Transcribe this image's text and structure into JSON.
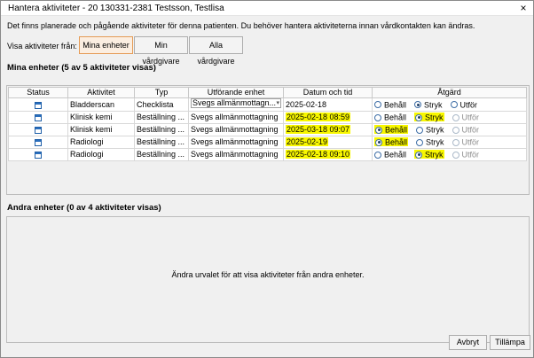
{
  "window": {
    "title": "Hantera aktiviteter - 20 130331-2381 Testsson, Testlisa",
    "close": "×"
  },
  "info_text": "Det finns planerade och pågående aktiviteter för denna patienten. Du behöver hantera aktiviteterna innan vårdkontakten kan ändras.",
  "filter": {
    "label": "Visa aktiviteter från:",
    "options": [
      "Mina enheter",
      "Min vårdgivare",
      "Alla vårdgivare"
    ],
    "selected": "Mina enheter"
  },
  "my_units": {
    "title": "Mina enheter (5 av 5 aktiviteter visas)",
    "columns": [
      "Status",
      "Aktivitet",
      "Typ",
      "Utförande enhet",
      "Datum och tid",
      "Åtgärd"
    ],
    "rows": [
      {
        "status_icon": "calendar-icon",
        "activity": "Bladderscan",
        "type": "Checklista",
        "unit": "Svegs allmänmottagn...",
        "unit_is_select": true,
        "datetime": "2025-02-18",
        "highlight": false,
        "choice": "Stryk",
        "choice_highlight": false,
        "behall_highlight": false
      },
      {
        "status_icon": "calendar-icon",
        "activity": "Klinisk kemi",
        "type": "Beställning ...",
        "unit": "Svegs allmänmottagning",
        "unit_is_select": false,
        "datetime": "2025-02-18 08:59",
        "highlight": true,
        "choice": "Stryk",
        "choice_highlight": true,
        "behall_highlight": false
      },
      {
        "status_icon": "calendar-icon",
        "activity": "Klinisk kemi",
        "type": "Beställning ...",
        "unit": "Svegs allmänmottagning",
        "unit_is_select": false,
        "datetime": "2025-03-18 09:07",
        "highlight": true,
        "choice": "Behåll",
        "choice_highlight": false,
        "behall_highlight": true
      },
      {
        "status_icon": "calendar-icon",
        "activity": "Radiologi",
        "type": "Beställning ...",
        "unit": "Svegs allmänmottagning",
        "unit_is_select": false,
        "datetime": "2025-02-19",
        "highlight": true,
        "choice": "Behåll",
        "choice_highlight": false,
        "behall_highlight": true
      },
      {
        "status_icon": "calendar-icon",
        "activity": "Radiologi",
        "type": "Beställning ...",
        "unit": "Svegs allmänmottagning",
        "unit_is_select": false,
        "datetime": "2025-02-18 09:10",
        "highlight": true,
        "choice": "Stryk",
        "choice_highlight": true,
        "behall_highlight": false
      }
    ],
    "action_labels": {
      "keep": "Behåll",
      "remove": "Stryk",
      "perform": "Utför"
    }
  },
  "other_units": {
    "title": "Andra enheter (0 av 4 aktiviteter visas)",
    "empty_message": "Ändra urvalet för att visa aktiviteter från andra enheter."
  },
  "buttons": {
    "cancel": "Avbryt",
    "apply": "Tillämpa"
  },
  "colors": {
    "highlight": "#f8f700",
    "active_segment_border": "#e59b55",
    "icon_blue": "#1f5fa8"
  }
}
